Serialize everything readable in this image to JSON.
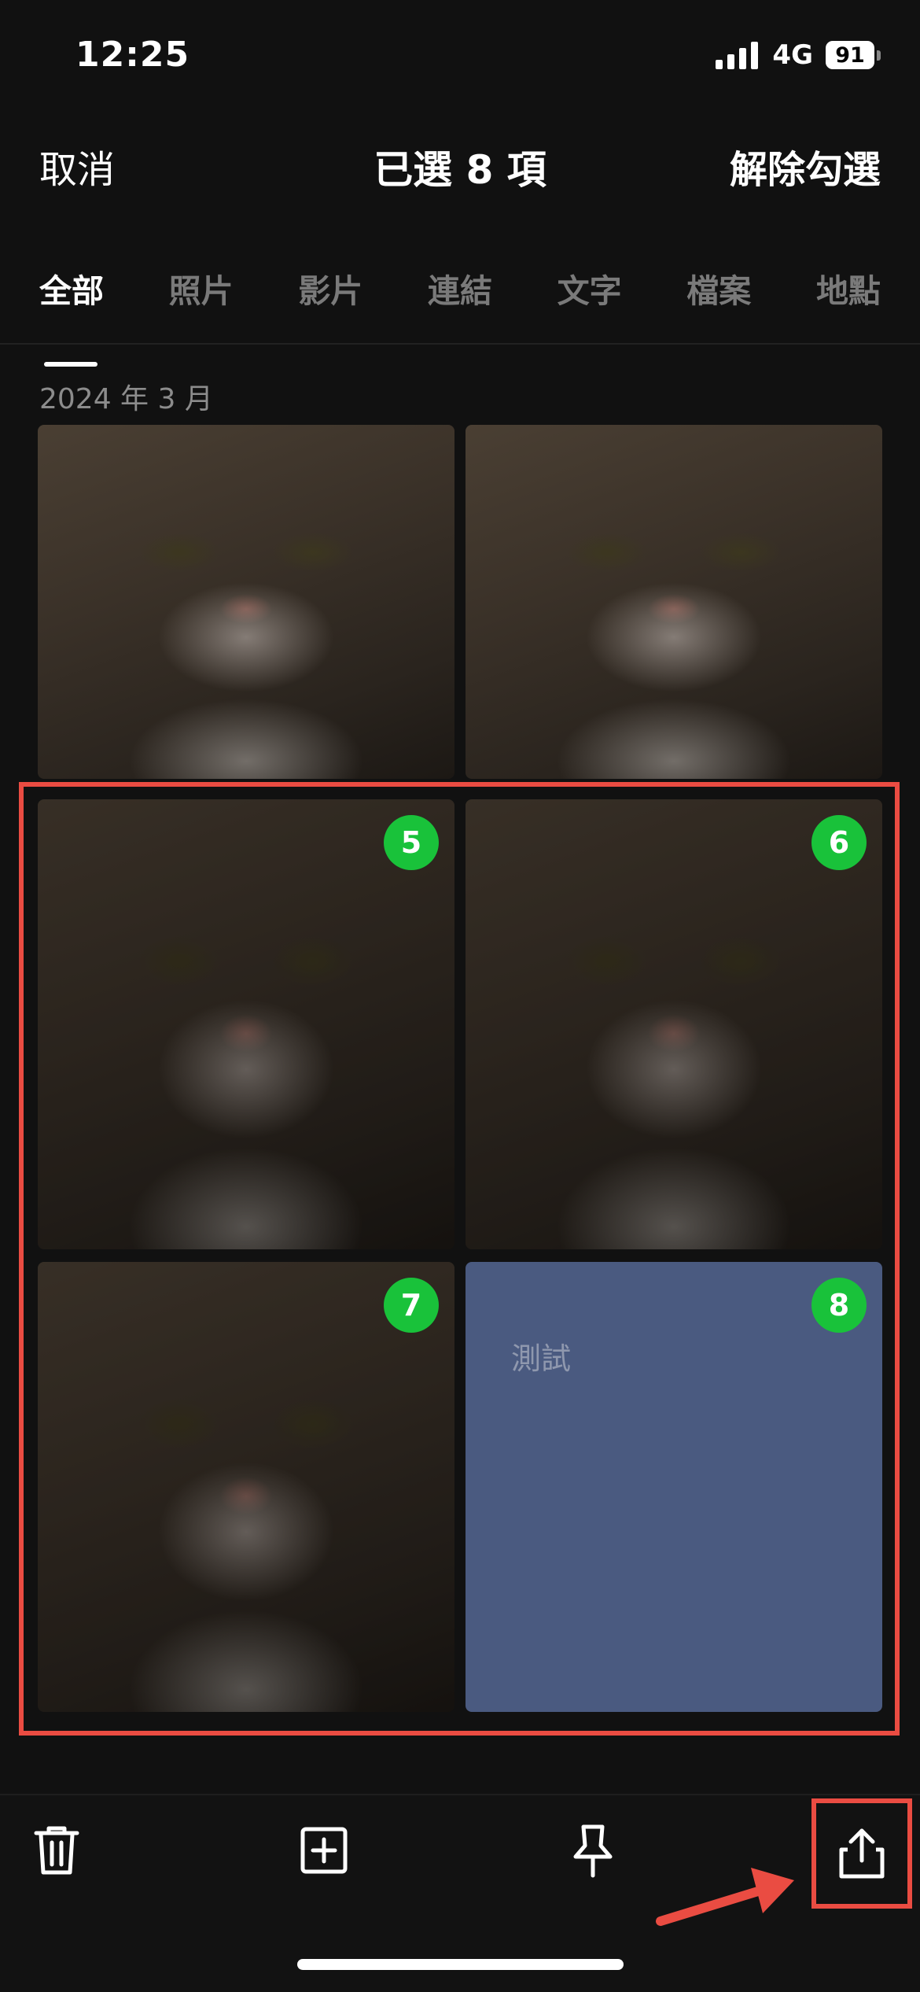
{
  "status_bar": {
    "time": "12:25",
    "network": "4G",
    "battery": "91"
  },
  "header": {
    "cancel_label": "取消",
    "title": "已選 8 項",
    "deselect_label": "解除勾選"
  },
  "tabs": [
    {
      "label": "全部",
      "active": true
    },
    {
      "label": "照片",
      "active": false
    },
    {
      "label": "影片",
      "active": false
    },
    {
      "label": "連結",
      "active": false
    },
    {
      "label": "文字",
      "active": false
    },
    {
      "label": "檔案",
      "active": false
    },
    {
      "label": "地點",
      "active": false
    }
  ],
  "section": {
    "date_label": "2024 年 3 月"
  },
  "items": [
    {
      "type": "photo",
      "selected": false
    },
    {
      "type": "photo",
      "selected": false
    },
    {
      "type": "photo",
      "selected": true,
      "badge": "5"
    },
    {
      "type": "photo",
      "selected": true,
      "badge": "6"
    },
    {
      "type": "photo",
      "selected": true,
      "badge": "7"
    },
    {
      "type": "note",
      "selected": true,
      "badge": "8",
      "text": "測試",
      "color": "#4a5a80"
    }
  ],
  "toolbar": {
    "icons": [
      "trash-icon",
      "add-square-icon",
      "pin-icon",
      "share-icon"
    ]
  },
  "colors": {
    "background": "#111111",
    "badge": "#19c23a",
    "highlight": "#ea4c42",
    "note": "#4a5a80"
  }
}
